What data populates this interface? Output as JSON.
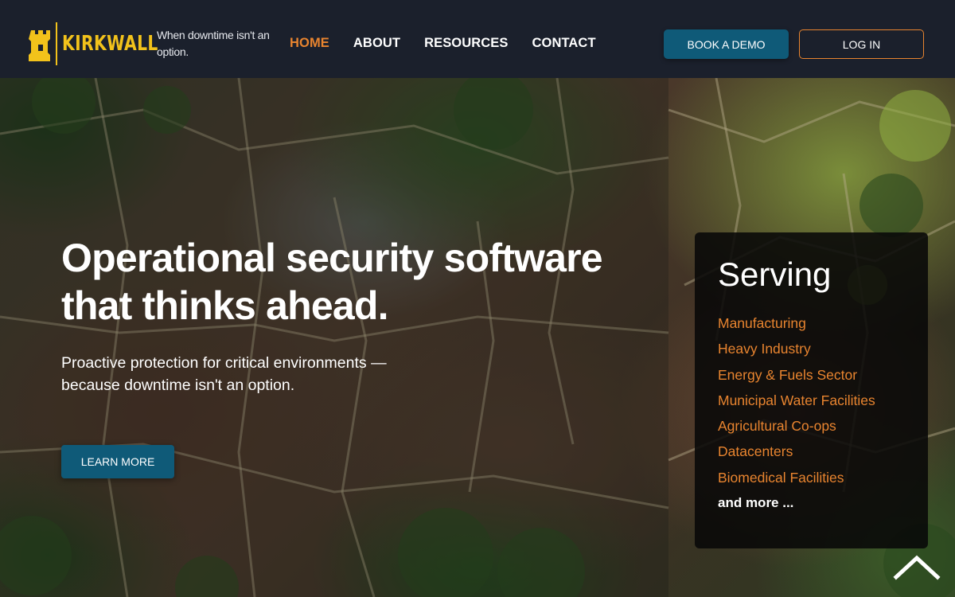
{
  "brand": {
    "name": "KIRKWALL",
    "tagline": "When downtime isn't an option.",
    "accent_color": "#f2c21b",
    "logo_icon": "rook-icon"
  },
  "nav": {
    "items": [
      {
        "label": "HOME",
        "active": true
      },
      {
        "label": "ABOUT",
        "active": false
      },
      {
        "label": "RESOURCES",
        "active": false
      },
      {
        "label": "CONTACT",
        "active": false
      }
    ],
    "active_color": "#e8842f"
  },
  "header_actions": {
    "book_demo": "BOOK A DEMO",
    "log_in": "LOG IN"
  },
  "hero": {
    "headline": "Operational security software that thinks ahead.",
    "subheadline": "Proactive protection for critical environments — because downtime isn't an option.",
    "cta": "LEARN MORE",
    "cta_color": "#0f5a78"
  },
  "serving": {
    "title": "Serving",
    "items": [
      "Manufacturing",
      "Heavy Industry",
      "Energy & Fuels Sector",
      "Municipal Water Facilities",
      "Agricultural Co-ops",
      "Datacenters",
      "Biomedical Facilities"
    ],
    "more": "and more ...",
    "item_color": "#e8842f"
  },
  "scroll_top_icon": "chevron-up-icon"
}
